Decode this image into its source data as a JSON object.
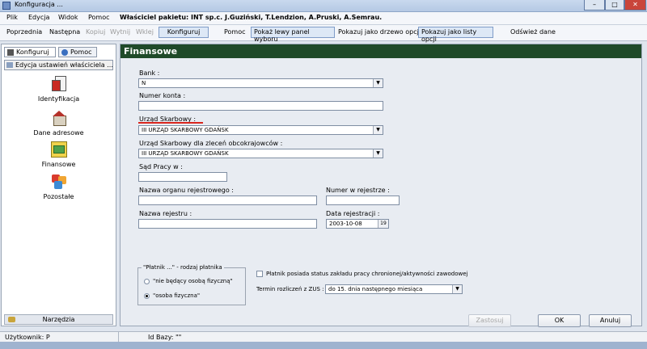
{
  "window": {
    "title": "Konfiguracja ...",
    "controls": {
      "minimize": "–",
      "maximize": "□",
      "close": "✕"
    }
  },
  "menu": {
    "items": [
      "Plik",
      "Edycja",
      "Widok",
      "Pomoc"
    ],
    "owner": "Właściciel pakietu: INT sp.c. J.Guziński, T.Lendzion, A.Pruski, A.Semrau."
  },
  "toolbar": {
    "prev": "Poprzednia",
    "next": "Następna",
    "copy": "Kopiuj",
    "cut": "Wytnij",
    "paste": "Wklej",
    "configure": "Konfiguruj",
    "help": "Pomoc",
    "show_left": "Pokaż lewy panel wyboru",
    "show_tree": "Pokazuj jako drzewo opcji",
    "show_list": "Pokazuj jako listy opcji",
    "refresh": "Odśwież dane"
  },
  "left_panel": {
    "tabs": [
      "Konfiguruj",
      "Pomoc"
    ],
    "heading": "Edycja ustawień właściciela ...",
    "items": [
      {
        "label": "Identyfikacja",
        "icon": "identification-icon"
      },
      {
        "label": "Dane adresowe",
        "icon": "address-icon"
      },
      {
        "label": "Finansowe",
        "icon": "finance-icon"
      },
      {
        "label": "Pozostałe",
        "icon": "other-icon"
      }
    ],
    "tools": "Narzędzia"
  },
  "main": {
    "title": "Finansowe",
    "bank": {
      "label": "Bank :",
      "value": "N"
    },
    "account": {
      "label": "Numer konta :",
      "value": ""
    },
    "tax_office": {
      "label": "Urząd Skarbowy :",
      "value": "III URZĄD SKARBOWY GDAŃSK"
    },
    "tax_office_foreign": {
      "label": "Urząd Skarbowy dla zleceń obcokrajowców :",
      "value": "III URZĄD SKARBOWY GDAŃSK"
    },
    "labor_court": {
      "label": "Sąd Pracy w :",
      "value": ""
    },
    "registry_organ": {
      "label": "Nazwa organu rejestrowego :",
      "value": ""
    },
    "registry_number": {
      "label": "Numer w rejestrze :",
      "value": ""
    },
    "registry_name": {
      "label": "Nazwa rejestru :",
      "value": ""
    },
    "registration_date": {
      "label": "Data rejestracji :",
      "value": "2003-10-08",
      "calendar": "19"
    },
    "payer_group": {
      "title": "\"Płatnik ...\" - rodzaj płatnika",
      "options": [
        "\"nie będący osobą fizyczną\"",
        "\"osoba fizyczna\""
      ],
      "selected_index": 1
    },
    "sheltered_checkbox": {
      "label": "Płatnik posiada status zakładu pracy chronionej/aktywności zawodowej",
      "checked": false
    },
    "zus_deadline": {
      "label": "Termin rozliczeń z ZUS :",
      "value": "do 15. dnia następnego miesiąca"
    },
    "buttons": {
      "apply": "Zastosuj",
      "ok": "OK",
      "cancel": "Anuluj"
    }
  },
  "status": {
    "user": "Użytkownik: P",
    "db": "Id Bazy: \"\""
  }
}
